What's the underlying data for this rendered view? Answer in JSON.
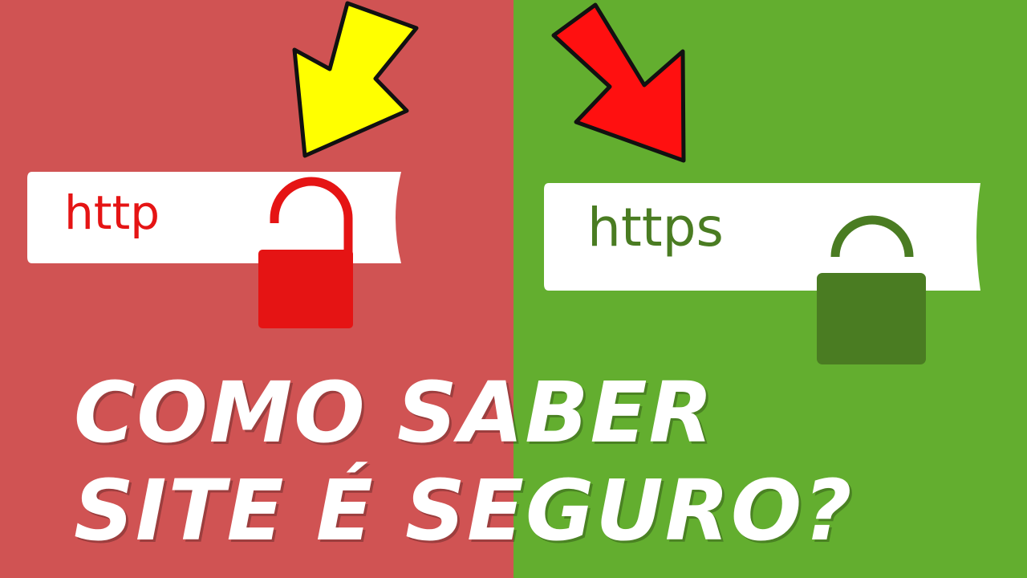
{
  "colors": {
    "left_bg": "#d05353",
    "right_bg": "#63ae2f",
    "http_red": "#e51414",
    "https_green": "#4a7c22",
    "yellow_arrow": "#ffff00",
    "red_arrow": "#ff1010",
    "bar_white": "#ffffff",
    "headline_white": "#ffffff"
  },
  "left": {
    "url_text": "http",
    "arrow_icon": "yellow-arrow-icon",
    "lock_icon": "unlocked-padlock-icon"
  },
  "right": {
    "url_text": "https",
    "arrow_icon": "red-arrow-icon",
    "lock_icon": "locked-padlock-icon"
  },
  "headline": {
    "line1": "COMO SABER",
    "line2": "SITE É SEGURO?"
  }
}
